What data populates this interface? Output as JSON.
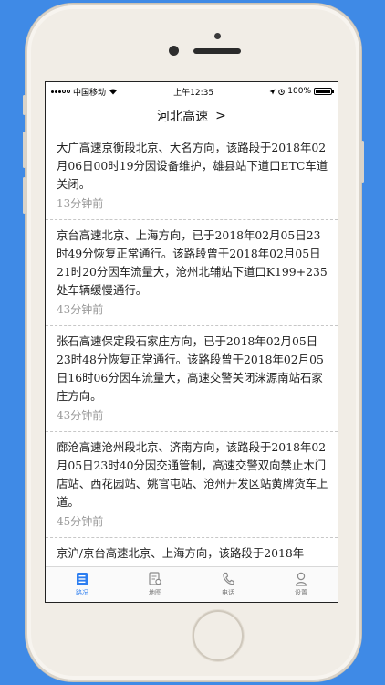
{
  "statusbar": {
    "carrier": "中国移动",
    "time": "上午12:35",
    "battery": "100%"
  },
  "header": {
    "title": "河北高速",
    "chevron": ">"
  },
  "news": [
    {
      "text": "大广高速京衡段北京、大名方向，该路段于2018年02月06日00时19分因设备维护，雄县站下道口ETC车道关闭。",
      "time": "13分钟前"
    },
    {
      "text": "京台高速北京、上海方向，已于2018年02月05日23时49分恢复正常通行。该路段曾于2018年02月05日21时20分因车流量大，沧州北辅站下道口K199+235处车辆缓慢通行。",
      "time": "43分钟前"
    },
    {
      "text": "张石高速保定段石家庄方向，已于2018年02月05日23时48分恢复正常通行。该路段曾于2018年02月05日16时06分因车流量大，高速交警关闭涞源南站石家庄方向。",
      "time": "43分钟前"
    },
    {
      "text": "廊沧高速沧州段北京、济南方向，该路段于2018年02月05日23时40分因交通管制，高速交警双向禁止木门店站、西花园站、姚官屯站、沧州开发区站黄牌货车上道。",
      "time": "45分钟前"
    },
    {
      "text": "京沪/京台高速北京、上海方向，该路段于2018年",
      "time": ""
    }
  ],
  "tabs": [
    {
      "label": "路况",
      "icon": "road-report-icon",
      "active": true
    },
    {
      "label": "地图",
      "icon": "map-icon",
      "active": false
    },
    {
      "label": "电话",
      "icon": "phone-icon",
      "active": false
    },
    {
      "label": "设置",
      "icon": "profile-icon",
      "active": false
    }
  ],
  "colors": {
    "background": "#3f8ae6",
    "accent": "#2d7ef0"
  }
}
